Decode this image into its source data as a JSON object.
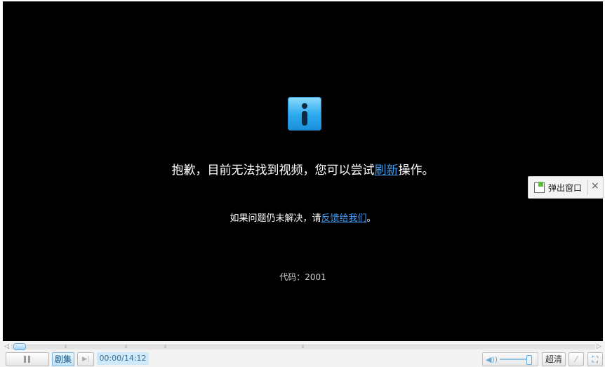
{
  "message": {
    "line1_prefix": "抱歉，目前无法找到视频，您可以尝试",
    "line1_link": "刷新",
    "line1_suffix": "操作。",
    "line2_prefix": "如果问题仍未解决，请",
    "line2_link": "反馈给我们",
    "line2_suffix": "。",
    "code": "代码：2001"
  },
  "popout": {
    "label": "弹出窗口",
    "close": "×"
  },
  "controls": {
    "episodes_label": "剧集",
    "time": "00:00/14:12",
    "hd_label": "超清",
    "progress_left": "◁",
    "progress_right": "▷",
    "next_icon": "▶|",
    "tool_icon": "⁄",
    "fullscreen_icon": "⛶",
    "volume_icon": "◀))"
  },
  "icons": {
    "info": "info-icon",
    "pause": "pause-icon"
  },
  "colors": {
    "link": "#3f9df0",
    "accent": "#6aa9d6"
  }
}
